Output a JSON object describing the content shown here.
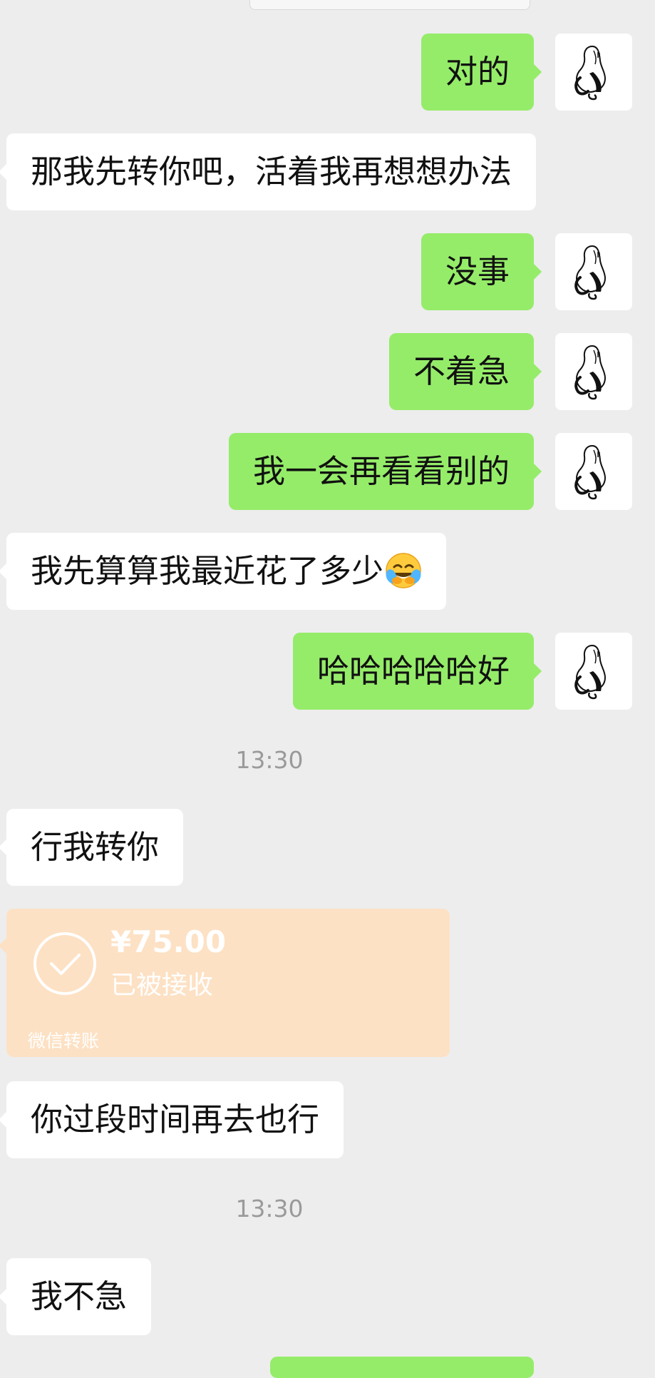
{
  "messages": [
    {
      "side": "out",
      "text": "对的"
    },
    {
      "side": "in",
      "text": "那我先转你吧，活着我再想想办法"
    },
    {
      "side": "out",
      "text": "没事"
    },
    {
      "side": "out",
      "text": "不着急"
    },
    {
      "side": "out",
      "text": "我一会再看看别的"
    },
    {
      "side": "in",
      "text": "我先算算我最近花了多少",
      "emoji": "crying-laughing-emoji"
    },
    {
      "side": "out",
      "text": "哈哈哈哈哈好"
    },
    {
      "type": "timestamp",
      "text": "13:30"
    },
    {
      "side": "in",
      "text": "行我转你"
    },
    {
      "type": "transfer",
      "amount": "¥75.00",
      "status": "已被接收",
      "label": "微信转账"
    },
    {
      "side": "in",
      "text": "你过段时间再去也行"
    },
    {
      "type": "timestamp",
      "text": "13:30"
    },
    {
      "side": "in",
      "text": "我不急"
    }
  ],
  "colors": {
    "background": "#ededed",
    "outgoing_bubble": "#95ec69",
    "incoming_bubble": "#ffffff",
    "transfer_card": "#fde1c4",
    "timestamp": "#9a9a9a"
  },
  "icons": {
    "avatar": "sketch-figure-avatar-icon",
    "transfer": "checkmark-circle-icon"
  }
}
